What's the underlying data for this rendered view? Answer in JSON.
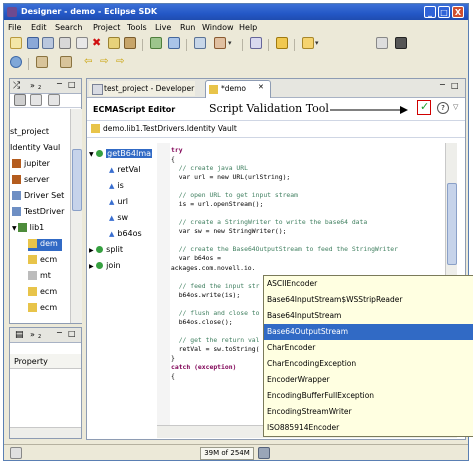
{
  "window": {
    "title": "Designer - demo - Eclipse SDK",
    "min": "_",
    "max": "□",
    "close": "X"
  },
  "menu": [
    "File",
    "Edit",
    "Search",
    "Project",
    "Tools",
    "Live",
    "Run",
    "Window",
    "Help"
  ],
  "left_top": {
    "tab1": "»",
    "tab1_count": "2",
    "items": [
      "st_project",
      "Identity Vaul",
      "jupiter",
      "server",
      "Driver Set",
      "TestDriver",
      "lib1",
      "dem",
      "ecm",
      "mt",
      "ecm",
      "ecm"
    ]
  },
  "left_bottom": {
    "tab_count": "2",
    "property_label": "Property"
  },
  "editor": {
    "tab_dev": "test_project - Developer",
    "tab_demo": "*demo",
    "header_title": "ECMAScript Editor",
    "breadcrumb": "demo.lib1.TestDrivers.Identity Vault",
    "annotation": "Script Validation Tool",
    "outline": [
      "getB64Ima",
      "retVal",
      "is",
      "url",
      "sw",
      "b64os",
      "split",
      "join"
    ],
    "code_lines": [
      "try",
      "{",
      "  // create java URL",
      "  var url = new URL(urlString);",
      "",
      "  // open URL to get input stream",
      "  is = url.openStream();",
      "",
      "  // create a StringWriter to write the base64 data",
      "  var sw = new StringWriter();",
      "",
      "  // create the Base64OutputStream to feed the StringWriter",
      "  var b64os =",
      "Packages.com.novell.io.",
      "",
      "  // feed the input str",
      "  b64os.write(is);",
      "",
      "  // flush and close to",
      "  b64os.close();",
      "",
      "  // get the return val",
      "  retVal = sw.toString(",
      "}",
      "catch (exception)",
      "{"
    ]
  },
  "autocomplete": {
    "items": [
      "ASCIIEncoder",
      "Base64InputStream$WSStripReader",
      "Base64InputStream",
      "Base64OutputStream",
      "CharEncoder",
      "CharEncodingException",
      "EncoderWrapper",
      "EncodingBufferFullException",
      "EncodingStreamWriter",
      "ISO885914Encoder"
    ],
    "selected_index": 3
  },
  "status": {
    "memory": "39M of 254M"
  },
  "colors": {
    "title_bg": "#2458c6",
    "selection": "#316ac5",
    "popup_bg": "#ffffe1",
    "validate_green": "#1b9e2b",
    "annotation_red": "#d00000"
  }
}
